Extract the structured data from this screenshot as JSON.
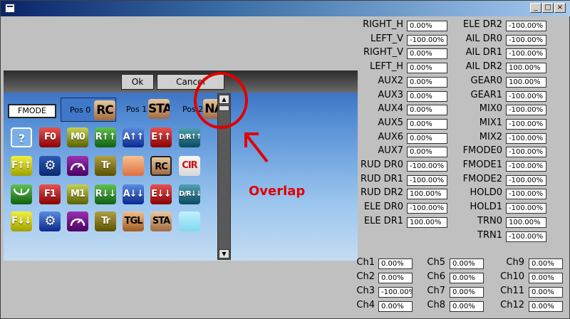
{
  "window": {
    "title": "",
    "controls": [
      "_",
      "□",
      "×"
    ]
  },
  "panel": {
    "ok_label": "Ok",
    "cancel_label": "Cancel",
    "fmode_label": "FMODE",
    "positions": [
      {
        "label": "Pos 0",
        "badge": "RC"
      },
      {
        "label": "Pos 1",
        "badge": "STA"
      },
      {
        "label": "Pos 2",
        "badge": "NA"
      }
    ],
    "scroll_up": "▲",
    "scroll_down": "▼",
    "icons_row1": [
      "?",
      "F0",
      "M0",
      "R↑↑",
      "A↑↑",
      "E↑↑",
      "D/R↑↑"
    ],
    "icons_row2": [
      "F↑↑",
      "gear",
      "gauge",
      "Tr",
      "",
      "RC",
      "CIR"
    ],
    "icons_row3": [
      "trim",
      "F1",
      "M1",
      "R↓↓",
      "A↓↓",
      "E↓↓",
      "D/R↓↓"
    ],
    "icons_row4": [
      "F↓↓",
      "gear",
      "gauge",
      "Tr",
      "TGL",
      "STA",
      ""
    ]
  },
  "annotation": {
    "text": "Overlap",
    "color": "#e00000"
  },
  "left_fields": [
    {
      "label": "RIGHT_H",
      "value": "0.00%"
    },
    {
      "label": "LEFT_V",
      "value": "-100.00%"
    },
    {
      "label": "RIGHT_V",
      "value": "0.00%"
    },
    {
      "label": "LEFT_H",
      "value": "0.00%"
    },
    {
      "label": "AUX2",
      "value": "0.00%"
    },
    {
      "label": "AUX3",
      "value": "0.00%"
    },
    {
      "label": "AUX4",
      "value": "0.00%"
    },
    {
      "label": "AUX5",
      "value": "0.00%"
    },
    {
      "label": "AUX6",
      "value": "0.00%"
    },
    {
      "label": "AUX7",
      "value": "0.00%"
    },
    {
      "label": "RUD DR0",
      "value": "-100.00%"
    },
    {
      "label": "RUD DR1",
      "value": "-100.00%"
    },
    {
      "label": "RUD DR2",
      "value": "100.00%"
    },
    {
      "label": "ELE DR0",
      "value": "-100.00%"
    },
    {
      "label": "ELE DR1",
      "value": "100.00%"
    }
  ],
  "right_fields": [
    {
      "label": "ELE DR2",
      "value": "-100.00%"
    },
    {
      "label": "AIL DR0",
      "value": "-100.00%"
    },
    {
      "label": "AIL DR1",
      "value": "-100.00%"
    },
    {
      "label": "AIL DR2",
      "value": "100.00%"
    },
    {
      "label": "GEAR0",
      "value": "100.00%"
    },
    {
      "label": "GEAR1",
      "value": "-100.00%"
    },
    {
      "label": "MIX0",
      "value": "-100.00%"
    },
    {
      "label": "MIX1",
      "value": "-100.00%"
    },
    {
      "label": "MIX2",
      "value": "-100.00%"
    },
    {
      "label": "FMODE0",
      "value": "-100.00%"
    },
    {
      "label": "FMODE1",
      "value": "-100.00%"
    },
    {
      "label": "FMODE2",
      "value": "-100.00%"
    },
    {
      "label": "HOLD0",
      "value": "-100.00%"
    },
    {
      "label": "HOLD1",
      "value": "-100.00%"
    },
    {
      "label": "TRN0",
      "value": "100.00%"
    },
    {
      "label": "TRN1",
      "value": "-100.00%"
    }
  ],
  "channels": [
    {
      "label": "Ch1",
      "value": "0.00%"
    },
    {
      "label": "Ch2",
      "value": "0.00%"
    },
    {
      "label": "Ch3",
      "value": "-100.00%"
    },
    {
      "label": "Ch4",
      "value": "0.00%"
    },
    {
      "label": "Ch5",
      "value": "0.00%"
    },
    {
      "label": "Ch6",
      "value": "0.00%"
    },
    {
      "label": "Ch7",
      "value": "0.00%"
    },
    {
      "label": "Ch8",
      "value": "0.00%"
    },
    {
      "label": "Ch9",
      "value": "0.00%"
    },
    {
      "label": "Ch10",
      "value": "0.00%"
    },
    {
      "label": "Ch11",
      "value": "0.00%"
    },
    {
      "label": "Ch12",
      "value": "0.00%"
    }
  ]
}
